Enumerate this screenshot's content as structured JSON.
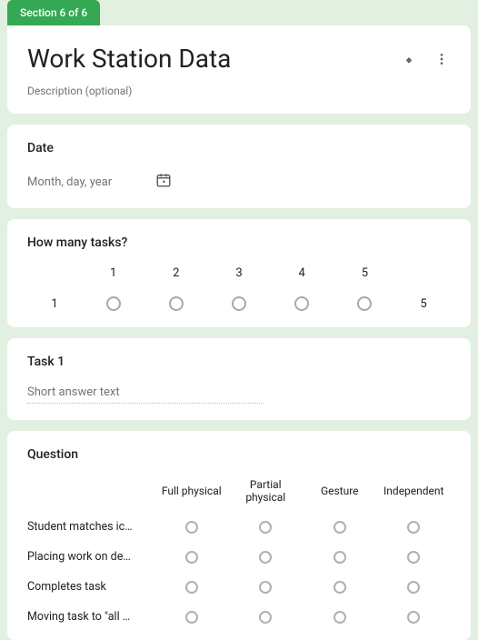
{
  "section": {
    "badge": "Section 6 of 6"
  },
  "header": {
    "title": "Work Station Data",
    "description": "Description (optional)"
  },
  "date_question": {
    "title": "Date",
    "placeholder": "Month, day, year"
  },
  "scale_question": {
    "title": "How many tasks?",
    "low_label": "1",
    "high_label": "5",
    "options": [
      "1",
      "2",
      "3",
      "4",
      "5"
    ]
  },
  "short_answer": {
    "title": "Task 1",
    "placeholder": "Short answer text"
  },
  "grid_question": {
    "title": "Question",
    "columns": [
      "Full physical",
      "Partial physical",
      "Gesture",
      "Independent"
    ],
    "rows": [
      "Student matches ic…",
      "Placing work on de…",
      "Completes task",
      "Moving task to \"all …"
    ]
  }
}
